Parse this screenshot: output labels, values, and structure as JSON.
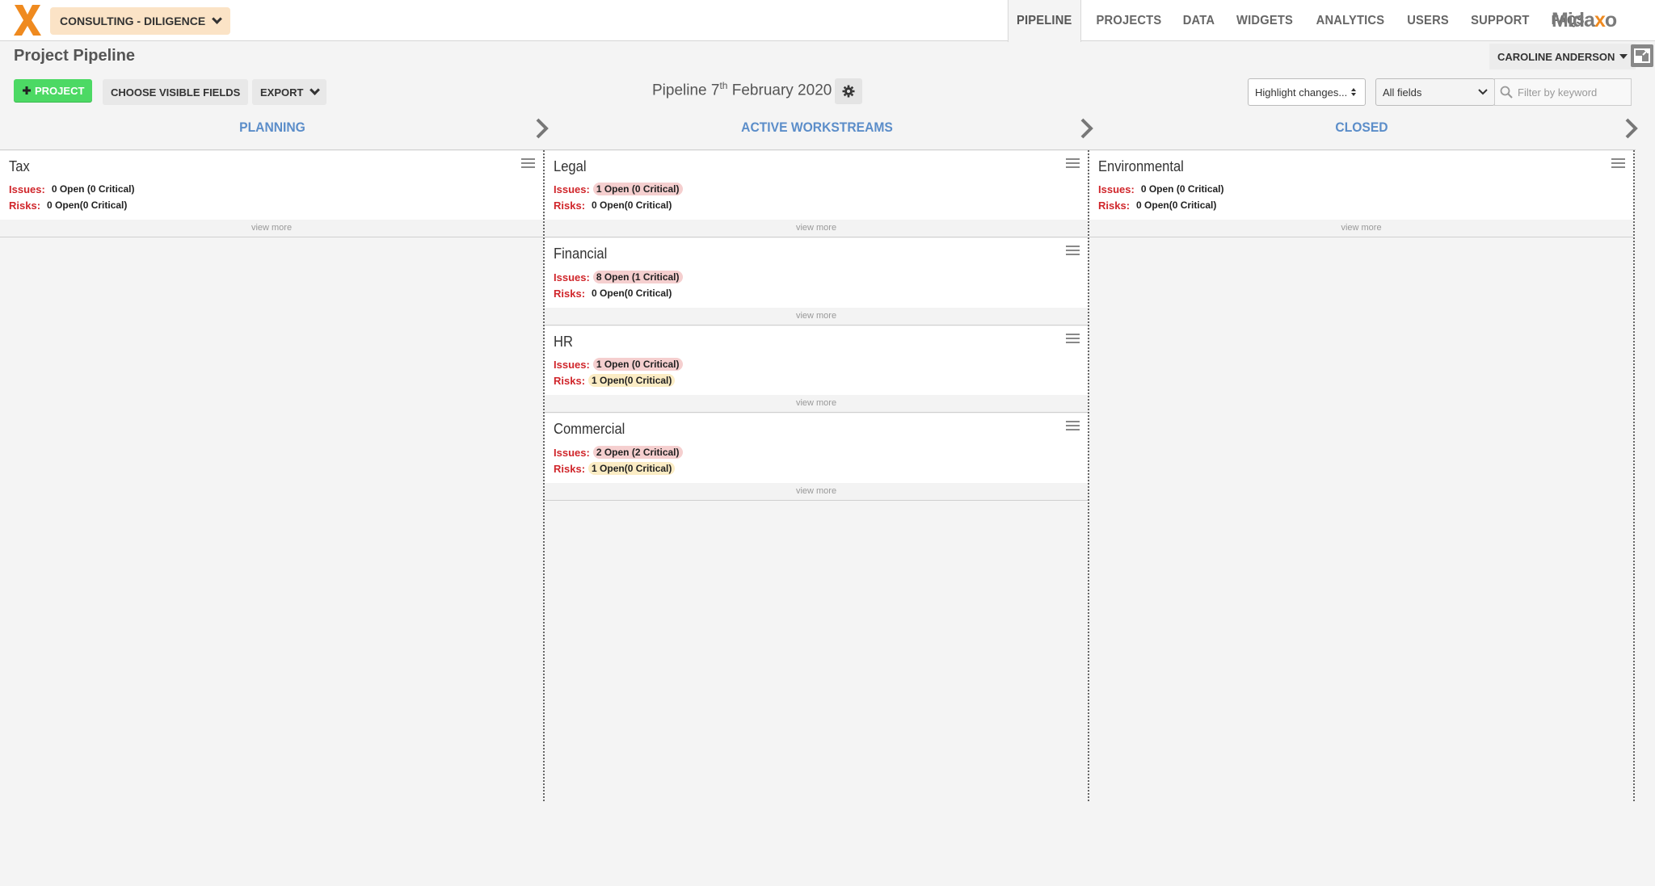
{
  "header": {
    "workspace": "CONSULTING - DILIGENCE",
    "nav": [
      "PIPELINE",
      "PROJECTS",
      "DATA",
      "WIDGETS",
      "ANALYTICS",
      "USERS",
      "SUPPORT",
      "FAQS"
    ],
    "brand_pre": "Mida",
    "brand_x": "x",
    "brand_post": "o",
    "user": "CAROLINE ANDERSON"
  },
  "page": {
    "title": "Project Pipeline"
  },
  "toolbar": {
    "project_label": "PROJECT",
    "choose_fields": "CHOOSE VISIBLE FIELDS",
    "export": "EXPORT",
    "pipeline_prefix": "Pipeline 7",
    "pipeline_sup": "th",
    "pipeline_suffix": " February 2020",
    "highlight": "Highlight changes...",
    "fields": "All fields",
    "filter_placeholder": "Filter by keyword"
  },
  "columns": [
    "PLANNING",
    "ACTIVE WORKSTREAMS",
    "CLOSED"
  ],
  "labels": {
    "issues": "Issues:",
    "risks": "Risks:",
    "view_more": "view more"
  },
  "cards": [
    {
      "title": "Tax",
      "issues": "0 Open  (0 Critical)",
      "risks": "0 Open(0 Critical)"
    },
    {
      "title": "Legal",
      "issues": "1 Open  (0 Critical)",
      "risks": "0 Open(0 Critical)"
    },
    {
      "title": "Financial",
      "issues": "8 Open  (1 Critical)",
      "risks": "0 Open(0 Critical)"
    },
    {
      "title": "HR",
      "issues": "1 Open  (0 Critical)",
      "risks": "1 Open(0 Critical)"
    },
    {
      "title": "Commercial",
      "issues": "2 Open  (2 Critical)",
      "risks": "1 Open(0 Critical)"
    },
    {
      "title": "Environmental",
      "issues": "0 Open  (0 Critical)",
      "risks": "0 Open(0 Critical)"
    }
  ],
  "colors": {
    "accent_orange": "#ef8a1f",
    "column_blue": "#5b8dc9",
    "label_red": "#d0262b",
    "add_green": "#4cd964"
  }
}
